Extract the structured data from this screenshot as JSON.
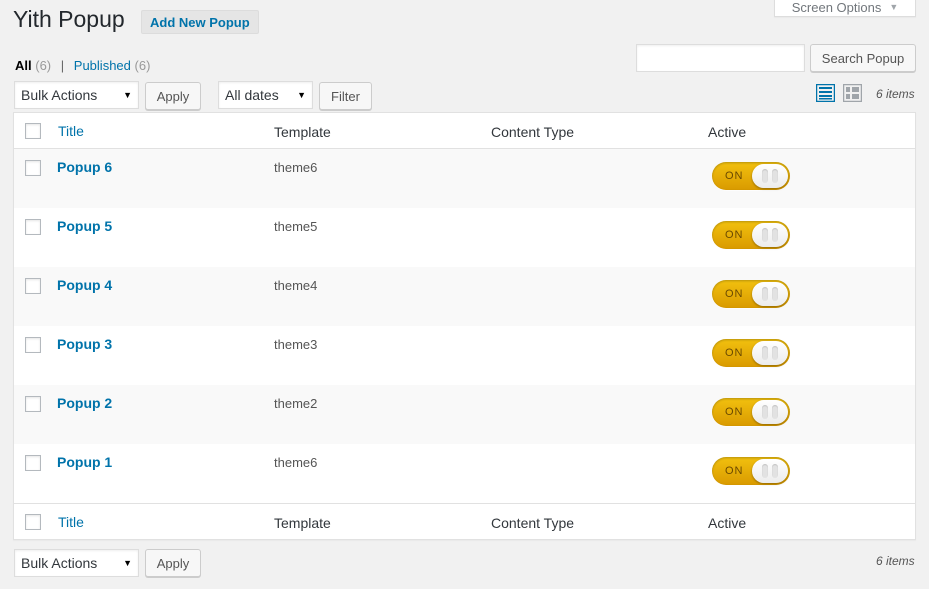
{
  "header": {
    "title": "Yith Popup",
    "add_new_label": "Add New Popup",
    "screen_options_label": "Screen Options"
  },
  "filters": {
    "all_label": "All",
    "all_count": "(6)",
    "separator": "|",
    "published_label": "Published",
    "published_count": "(6)"
  },
  "search": {
    "placeholder": "",
    "button_label": "Search Popup"
  },
  "tablenav_top": {
    "bulk_actions": "Bulk Actions",
    "apply_label": "Apply",
    "dates": "All dates",
    "filter_label": "Filter",
    "items_count": "6 items"
  },
  "tablenav_bottom": {
    "bulk_actions": "Bulk Actions",
    "apply_label": "Apply",
    "items_count": "6 items"
  },
  "columns": {
    "title": "Title",
    "template": "Template",
    "content_type": "Content Type",
    "active": "Active"
  },
  "rows": [
    {
      "title": "Popup 6",
      "template": "theme6",
      "content_type": "",
      "active": "ON"
    },
    {
      "title": "Popup 5",
      "template": "theme5",
      "content_type": "",
      "active": "ON"
    },
    {
      "title": "Popup 4",
      "template": "theme4",
      "content_type": "",
      "active": "ON"
    },
    {
      "title": "Popup 3",
      "template": "theme3",
      "content_type": "",
      "active": "ON"
    },
    {
      "title": "Popup 2",
      "template": "theme2",
      "content_type": "",
      "active": "ON"
    },
    {
      "title": "Popup 1",
      "template": "theme6",
      "content_type": "",
      "active": "ON"
    }
  ],
  "colors": {
    "link": "#0073aa",
    "toggle_on": "#f2c10f"
  }
}
